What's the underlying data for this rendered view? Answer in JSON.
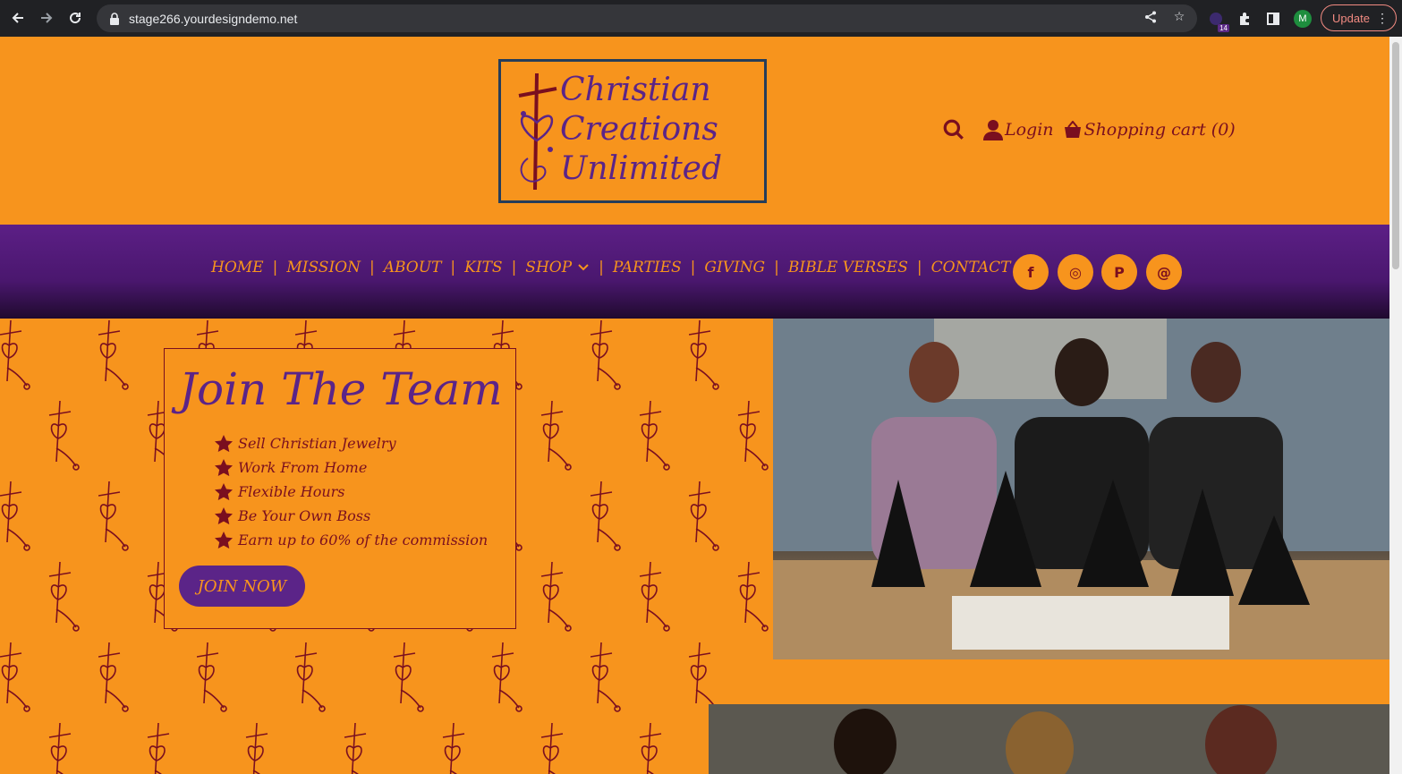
{
  "browser": {
    "url": "stage266.yourdesigndemo.net",
    "extension_badge": "14",
    "profile_initial": "M",
    "update_label": "Update"
  },
  "header": {
    "logo": {
      "line1": "Christian",
      "line2": "Creations",
      "line3": "Unlimited"
    },
    "login_label": "Login",
    "cart_label": "Shopping cart (0)"
  },
  "nav": {
    "items": [
      {
        "label": "HOME"
      },
      {
        "label": "MISSION"
      },
      {
        "label": "ABOUT"
      },
      {
        "label": "KITS"
      },
      {
        "label": "SHOP"
      },
      {
        "label": "PARTIES"
      },
      {
        "label": "GIVING"
      },
      {
        "label": "BIBLE VERSES"
      },
      {
        "label": "CONTACT"
      }
    ],
    "social": [
      {
        "name": "facebook-icon",
        "glyph": "f"
      },
      {
        "name": "instagram-icon",
        "glyph": "◎"
      },
      {
        "name": "pinterest-icon",
        "glyph": "P"
      },
      {
        "name": "threads-icon",
        "glyph": "@"
      }
    ]
  },
  "hero": {
    "title": "Join The Team",
    "bullets": [
      "Sell Christian Jewelry",
      "Work From Home",
      "Flexible Hours",
      "Be Your Own Boss",
      "Earn up to 60% of the commission"
    ],
    "cta_label": "JOIN NOW"
  },
  "colors": {
    "orange": "#f7941d",
    "purple": "#5b2488",
    "maroon": "#7a0f1f"
  }
}
